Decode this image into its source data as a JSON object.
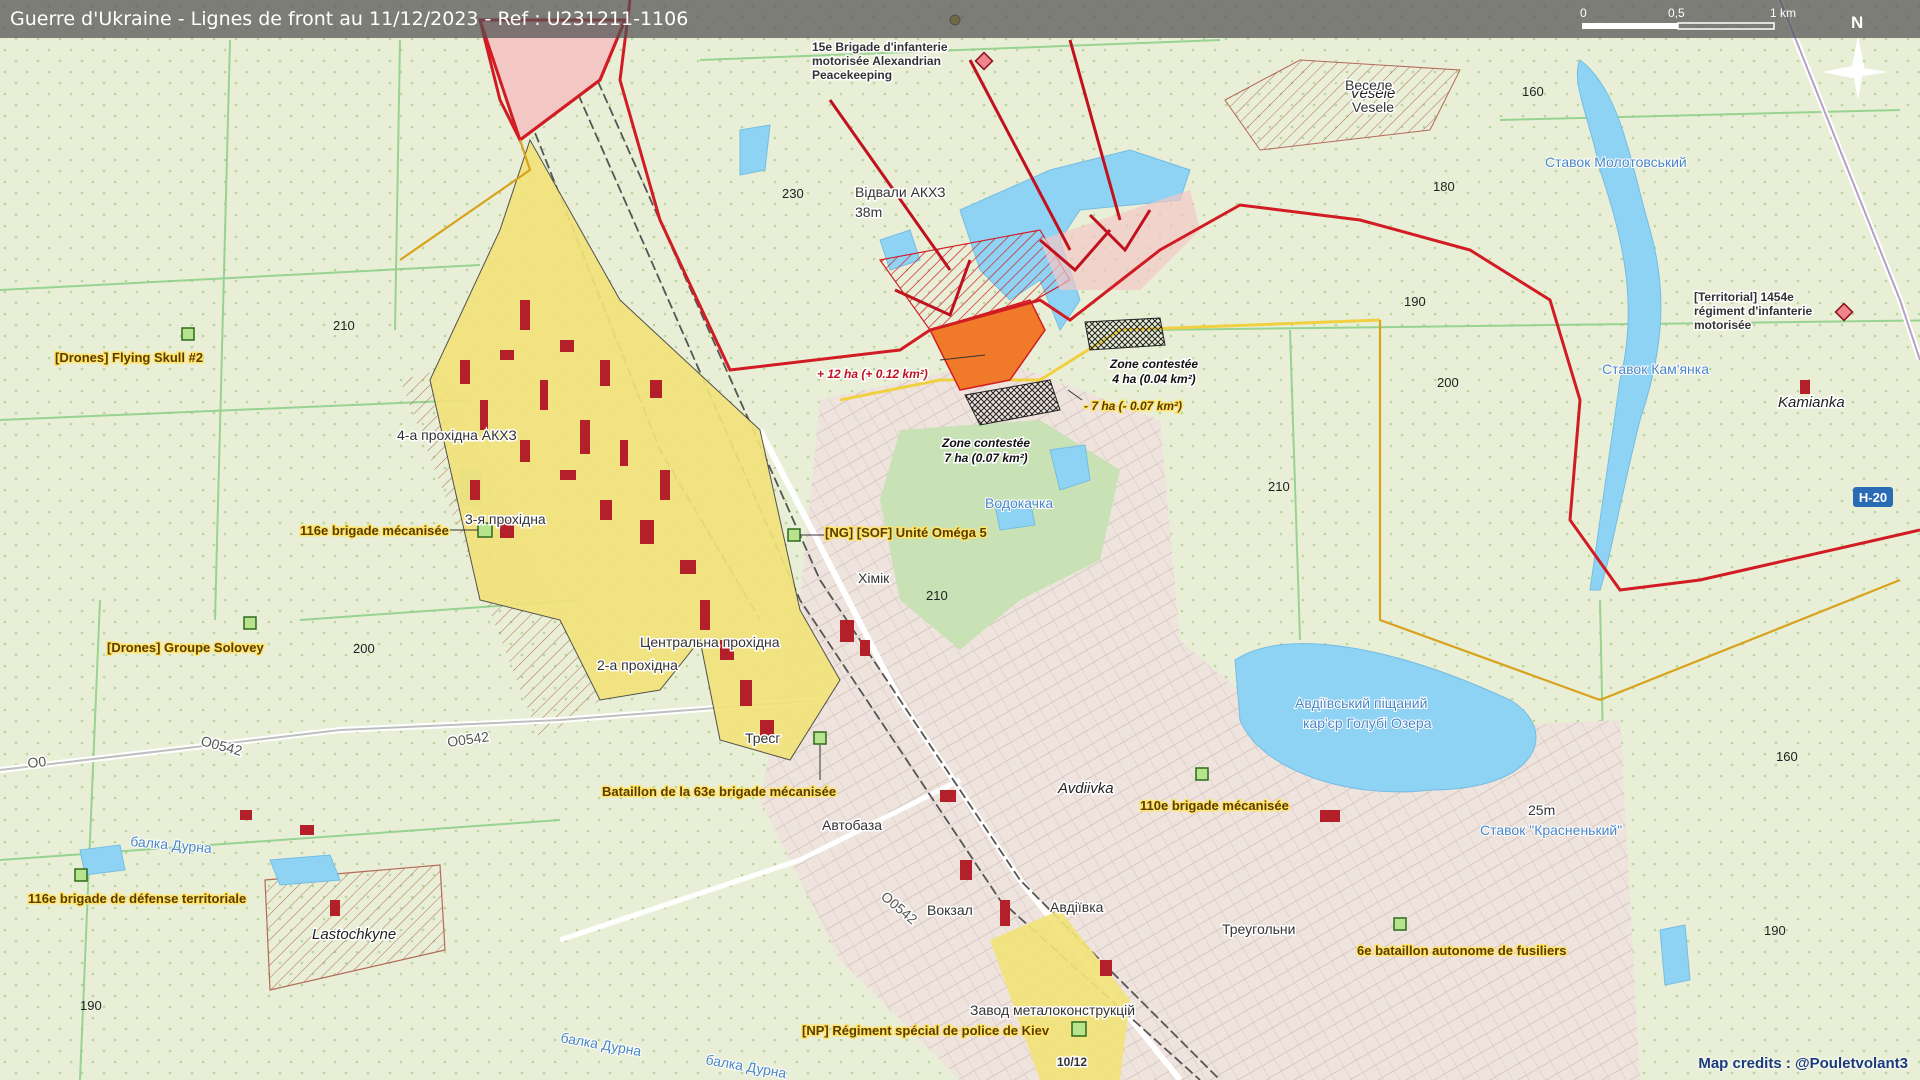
{
  "title": "Guerre d'Ukraine - Lignes de front au 11/12/2023 - Ref : U231211-1106",
  "credits": "Map credits : @Pouletvolant3",
  "scale": {
    "zero": "0",
    "half": "0,5",
    "one": "1 km"
  },
  "north": "N",
  "date_marker": "10/12",
  "road_shield": "H-20",
  "colors": {
    "front_line": "#d21c24",
    "ua_control": "#f0e06a",
    "contested": "#3a3a3a",
    "ru_gain": "#f07a2a",
    "water": "#8fd3f4"
  },
  "units": {
    "flying_skull": "[Drones] Flying Skull #2",
    "b116_mech": "116e brigade mécanisée",
    "solovey": "[Drones] Groupe Solovey",
    "omega": "[NG] [SOF] Unité Oméga 5",
    "bat63": "Bataillon de la 63e brigade mécanisée",
    "b110": "110e brigade mécanisée",
    "b116_td": "116e brigade de défense territoriale",
    "bat6": "6e bataillon autonome de fusiliers",
    "police": "[NP] Régiment spécial de police de Kiev",
    "ru15_1": "15e Brigade d'infanterie",
    "ru15_2": "motorisée Alexandrian",
    "ru15_3": "Peacekeeping",
    "ru1454_1": "[Territorial] 1454e",
    "ru1454_2": "régiment d'infanterie",
    "ru1454_3": "motorisée"
  },
  "zones": {
    "z1_title": "Zone contestée",
    "z1_area": "4 ha (0.04 km²)",
    "z2_title": "Zone contestée",
    "z2_area": "7 ha (0.07 km²)",
    "gain": "+ 12 ha (+ 0.12 km²)",
    "loss": "- 7 ha (- 0.07 km²)"
  },
  "places": {
    "vesele_lat": "Vesele",
    "vesele_cyr1": "Веселе",
    "vesele_cyr2": "Vesele",
    "avdiivka": "Avdiivka",
    "avdiivka_cyr": "Авдіївка",
    "kamianka": "Kamianka",
    "lastochkyne": "Lastochkyne",
    "akhz": "4-а прохідна АКХЗ",
    "prokh3": "3-я прохідна",
    "prokh2": "2-а прохідна",
    "central": "Центральна прохідна",
    "khimik": "Хімік",
    "tres": "Тресг",
    "avtobaza": "Автобаза",
    "vokzal": "Вокзал",
    "zavod": "Завод металоконструкцій",
    "treugolni": "Треугольни",
    "vidvaly": "Відвали АКХЗ",
    "vidvaly_h": "38m",
    "h25": "25m"
  },
  "water": {
    "molot": "Ставок Молотовський",
    "kamianka": "Ставок Кам'янка",
    "vodokachka": "Водокачка",
    "kar1": "Авдіївський піщаний",
    "kar2": "кар'єр Голубі Озера",
    "krasn": "Ставок \"Красненький\"",
    "balka1": "балка Дурна",
    "balka2": "балка Дурна",
    "balka3": "балка Дурна"
  },
  "roads": {
    "o0542a": "O0542",
    "o0542b": "O0542",
    "o0542c": "O0542",
    "o0": "O0"
  },
  "elevations": [
    "230",
    "210",
    "200",
    "160",
    "180",
    "190",
    "200",
    "210",
    "210",
    "160",
    "190",
    "190"
  ]
}
